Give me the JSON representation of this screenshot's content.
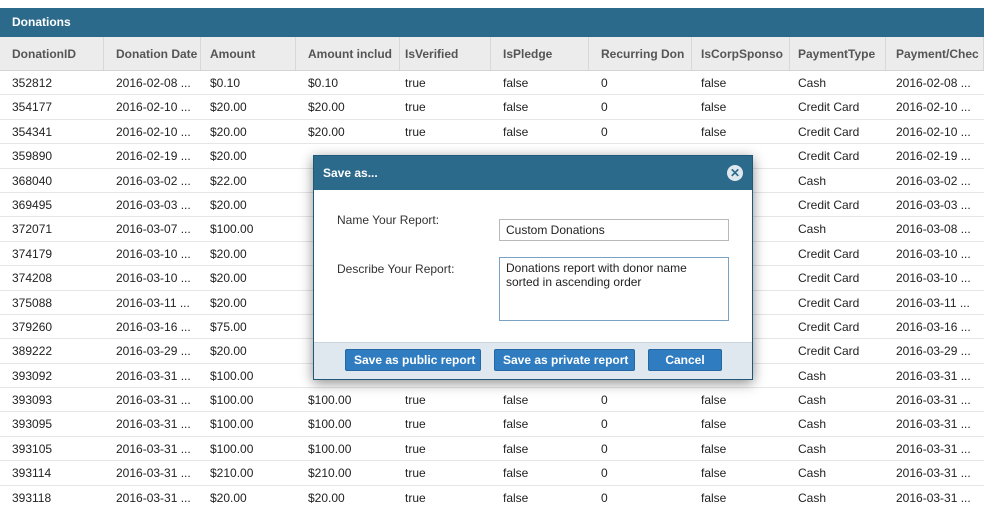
{
  "panel": {
    "title": "Donations"
  },
  "columns": [
    "DonationID",
    "Donation Date",
    "Amount",
    "Amount includ",
    "IsVerified",
    "IsPledge",
    "Recurring Don",
    "IsCorpSponso",
    "PaymentType",
    "Payment/Chec"
  ],
  "rows": [
    [
      "352812",
      "2016-02-08 ...",
      "$0.10",
      "$0.10",
      "true",
      "false",
      "0",
      "false",
      "Cash",
      "2016-02-08 ..."
    ],
    [
      "354177",
      "2016-02-10 ...",
      "$20.00",
      "$20.00",
      "true",
      "false",
      "0",
      "false",
      "Credit Card",
      "2016-02-10 ..."
    ],
    [
      "354341",
      "2016-02-10 ...",
      "$20.00",
      "$20.00",
      "true",
      "false",
      "0",
      "false",
      "Credit Card",
      "2016-02-10 ..."
    ],
    [
      "359890",
      "2016-02-19 ...",
      "$20.00",
      "",
      "",
      "",
      "",
      "",
      "Credit Card",
      "2016-02-19 ..."
    ],
    [
      "368040",
      "2016-03-02 ...",
      "$22.00",
      "",
      "",
      "",
      "",
      "",
      "Cash",
      "2016-03-02 ..."
    ],
    [
      "369495",
      "2016-03-03 ...",
      "$20.00",
      "",
      "",
      "",
      "",
      "",
      "Credit Card",
      "2016-03-03 ..."
    ],
    [
      "372071",
      "2016-03-07 ...",
      "$100.00",
      "",
      "",
      "",
      "",
      "",
      "Cash",
      "2016-03-08 ..."
    ],
    [
      "374179",
      "2016-03-10 ...",
      "$20.00",
      "",
      "",
      "",
      "",
      "",
      "Credit Card",
      "2016-03-10 ..."
    ],
    [
      "374208",
      "2016-03-10 ...",
      "$20.00",
      "",
      "",
      "",
      "",
      "",
      "Credit Card",
      "2016-03-10 ..."
    ],
    [
      "375088",
      "2016-03-11 ...",
      "$20.00",
      "",
      "",
      "",
      "",
      "",
      "Credit Card",
      "2016-03-11 ..."
    ],
    [
      "379260",
      "2016-03-16 ...",
      "$75.00",
      "",
      "",
      "",
      "",
      "",
      "Credit Card",
      "2016-03-16 ..."
    ],
    [
      "389222",
      "2016-03-29 ...",
      "$20.00",
      "",
      "",
      "",
      "",
      "",
      "Credit Card",
      "2016-03-29 ..."
    ],
    [
      "393092",
      "2016-03-31 ...",
      "$100.00",
      "",
      "",
      "",
      "",
      "",
      "Cash",
      "2016-03-31 ..."
    ],
    [
      "393093",
      "2016-03-31 ...",
      "$100.00",
      "$100.00",
      "true",
      "false",
      "0",
      "false",
      "Cash",
      "2016-03-31 ..."
    ],
    [
      "393095",
      "2016-03-31 ...",
      "$100.00",
      "$100.00",
      "true",
      "false",
      "0",
      "false",
      "Cash",
      "2016-03-31 ..."
    ],
    [
      "393105",
      "2016-03-31 ...",
      "$100.00",
      "$100.00",
      "true",
      "false",
      "0",
      "false",
      "Cash",
      "2016-03-31 ..."
    ],
    [
      "393114",
      "2016-03-31 ...",
      "$210.00",
      "$210.00",
      "true",
      "false",
      "0",
      "false",
      "Cash",
      "2016-03-31 ..."
    ],
    [
      "393118",
      "2016-03-31 ...",
      "$20.00",
      "$20.00",
      "true",
      "false",
      "0",
      "false",
      "Cash",
      "2016-03-31 ..."
    ]
  ],
  "dialog": {
    "title": "Save as...",
    "close_icon": "close-icon",
    "name_label": "Name Your Report:",
    "name_value": "Custom Donations",
    "desc_label": "Describe Your Report:",
    "desc_value": "Donations report with donor name sorted in ascending order",
    "public_label": "Save as public report",
    "private_label": "Save as private report",
    "cancel_label": "Cancel"
  },
  "colors": {
    "header": "#2c6a8c",
    "button": "#2f7cc0",
    "footer": "#dfe8ef"
  }
}
